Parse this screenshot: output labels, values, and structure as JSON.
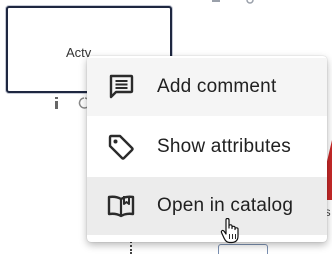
{
  "canvas": {
    "activity_label": "Actv",
    "side_text": "is",
    "accent_red": "#c62828",
    "node_border": "#1e2740"
  },
  "context_menu": {
    "items": [
      {
        "label": "Add comment",
        "icon": "comment-icon"
      },
      {
        "label": "Show attributes",
        "icon": "tag-icon"
      },
      {
        "label": "Open in catalog",
        "icon": "open-book-icon"
      }
    ],
    "hovered_item": "Open in catalog"
  },
  "cursor": {
    "icon": "hand-pointer-icon"
  }
}
